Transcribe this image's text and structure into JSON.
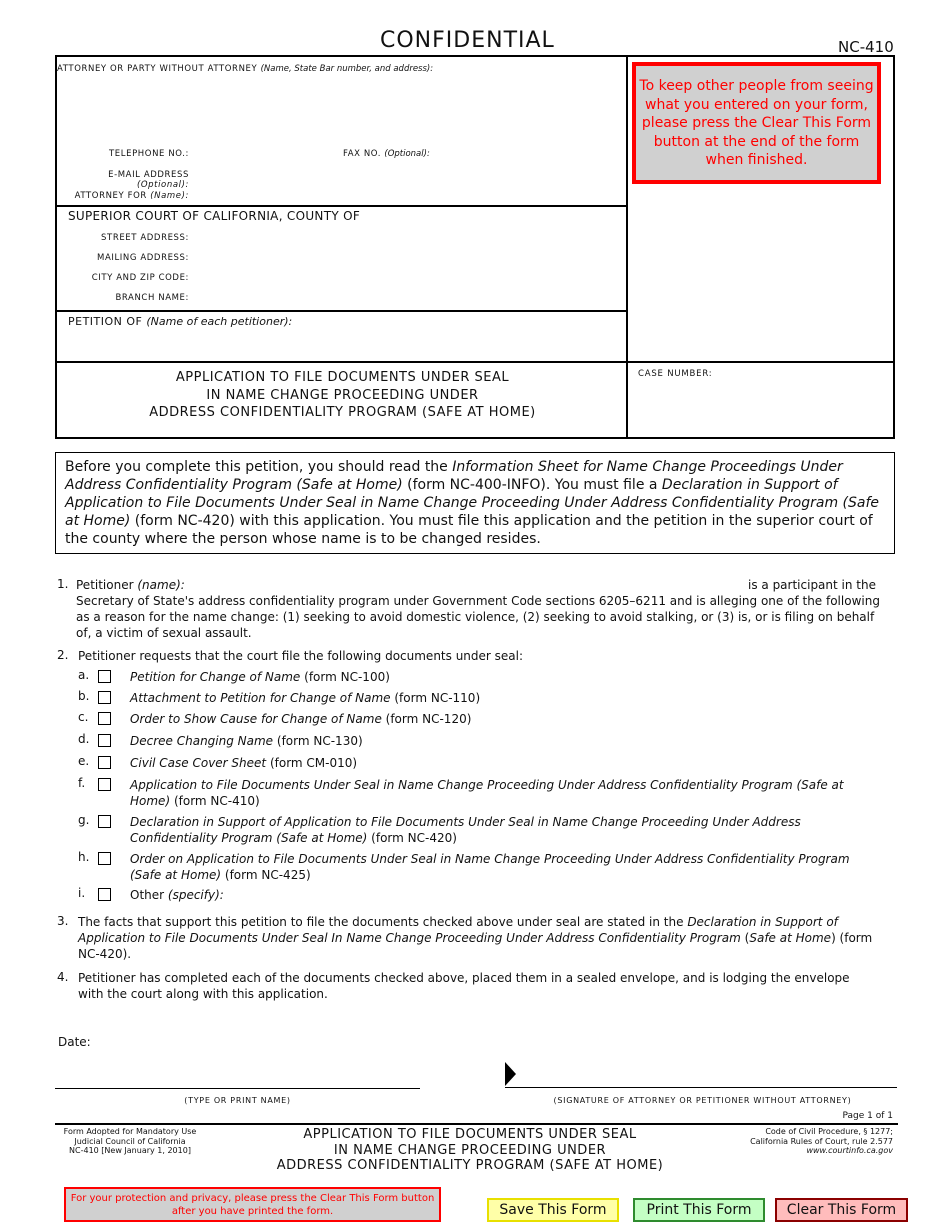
{
  "header": {
    "confidential": "CONFIDENTIAL",
    "form_number": "NC-410"
  },
  "caption": {
    "attorney_label": "ATTORNEY OR PARTY WITHOUT ATTORNEY",
    "attorney_label_italic": "(Name, State Bar number, and address):",
    "telephone_label": "TELEPHONE NO.:",
    "fax_label": "FAX NO.",
    "fax_label_italic": "(Optional):",
    "email_label": "E-MAIL ADDRESS",
    "email_label_italic": "(Optional):",
    "attorney_for_label": "ATTORNEY FOR",
    "attorney_for_italic": "(Name):",
    "court_title": "SUPERIOR COURT OF CALIFORNIA, COUNTY OF",
    "street_label": "STREET ADDRESS:",
    "mailing_label": "MAILING ADDRESS:",
    "city_label": "CITY AND ZIP CODE:",
    "branch_label": "BRANCH NAME:",
    "petition_of_label": "PETITION OF",
    "petition_of_italic": "(Name of each petitioner):",
    "title_lines": [
      "APPLICATION TO FILE DOCUMENTS UNDER SEAL",
      "IN NAME CHANGE PROCEEDING  UNDER",
      "ADDRESS CONFIDENTIALITY PROGRAM (SAFE AT HOME)"
    ],
    "case_number_label": "CASE NUMBER:",
    "privacy_notice": "To keep other people from seeing what you entered on your form, please press the Clear This Form button at the end of the form when finished."
  },
  "notice": {
    "t1": "Before you complete this petition, you should read the ",
    "i1": "Information Sheet for Name Change Proceedings Under Address Confidentiality Program (Safe at Home) ",
    "t2": "(form NC-400-INFO). You must file a ",
    "i2": "Declaration in Support of Application to File Documents Under Seal in Name Change Proceeding Under Address Confidentiality Program (Safe at Home)",
    "t3": " (form NC-420) with this application. You must file this application and the petition in the superior court of the county where the person whose name is to be changed resides."
  },
  "items": {
    "item1": {
      "num": "1.",
      "lead": "Petitioner ",
      "lead_italic": "(name):",
      "tail": "is a participant in the",
      "body": "Secretary of State's address confidentiality program under Government Code sections 6205–6211 and is alleging one of the following as a reason for the name change: (1) seeking to avoid domestic violence, (2) seeking to avoid stalking, or (3) is, or is filing on behalf of, a victim of sexual assault."
    },
    "item2": {
      "num": "2.",
      "text": "Petitioner requests that the court file the following documents under seal:",
      "subs": [
        {
          "letter": "a.",
          "title": "Petition for Change of Name",
          "form": " (form NC-100)",
          "checked": false
        },
        {
          "letter": "b.",
          "title": "Attachment to Petition for Change of Name",
          "form": " (form NC-110)",
          "checked": false
        },
        {
          "letter": "c.",
          "title": "Order to Show Cause for Change of Name",
          "form": " (form NC-120)",
          "checked": false
        },
        {
          "letter": "d.",
          "title": "Decree Changing Name",
          "form": " (form NC-130)",
          "checked": false
        },
        {
          "letter": "e.",
          "title": "Civil Case Cover Sheet",
          "form": " (form CM-010)",
          "checked": false
        },
        {
          "letter": "f.",
          "title": "Application to File Documents Under Seal in Name Change Proceeding Under Address Confidentiality Program (Safe at Home)",
          "form": " (form NC-410)",
          "checked": false
        },
        {
          "letter": "g.",
          "title": "Declaration in Support of Application to File Documents Under Seal in Name Change Proceeding Under Address Confidentiality Program (Safe at Home)",
          "form": " (form NC-420)",
          "checked": false
        },
        {
          "letter": "h.",
          "title": "Order on Application to File Documents Under Seal in Name Change Proceeding Under Address Confidentiality Program (Safe at Home)",
          "form": " (form NC-425)",
          "checked": false
        },
        {
          "letter": "i.",
          "title": "Other ",
          "title_italic": "(specify):",
          "checked": false
        }
      ]
    },
    "item3": {
      "num": "3.",
      "t1": "The facts that support this petition to file the documents checked above under seal are stated in the ",
      "i1": "Declaration in Support of Application to File Documents Under Seal In Name Change Proceeding Under Address Confidentiality Program",
      "t2": " (",
      "i2": "Safe at Home",
      "t3": ") (form NC-420)."
    },
    "item4": {
      "num": "4.",
      "text": "Petitioner has completed each of the documents checked above, placed them in a sealed envelope, and is lodging the envelope with the court along with this application."
    }
  },
  "signature": {
    "date_label": "Date:",
    "name_caption": "(TYPE OR PRINT NAME)",
    "sig_caption": "(SIGNATURE OF ATTORNEY OR PETITIONER WITHOUT  ATTORNEY)",
    "page_count": "Page 1 of 1"
  },
  "footer": {
    "left_lines": [
      "Form Adopted for Mandatory Use",
      "Judicial Council of California",
      "NC-410 [New January 1, 2010]"
    ],
    "title_lines": [
      "APPLICATION TO FILE DOCUMENTS UNDER SEAL",
      "IN NAME CHANGE PROCEEDING UNDER",
      "ADDRESS CONFIDENTIALITY PROGRAM (SAFE AT HOME)"
    ],
    "right_lines": [
      "Code of Civil Procedure, § 1277;",
      "California Rules of Court, rule 2.577",
      "www.courtinfo.ca.gov"
    ]
  },
  "actions": {
    "warning": "For your protection and privacy, please press the Clear This Form button after you have printed the form.",
    "save_label": "Save This Form",
    "print_label": "Print This Form",
    "clear_label": "Clear This Form",
    "colors": {
      "save": "#ffffa8",
      "print": "#c4ffc4",
      "clear": "#ffbcbc",
      "warning": "#ff0000"
    }
  }
}
